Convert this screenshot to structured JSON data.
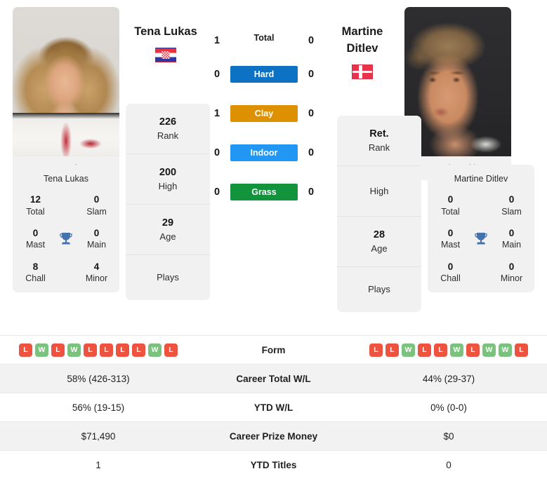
{
  "colors": {
    "hard": "#0D72C4",
    "clay": "#DD9100",
    "indoor": "#2196F3",
    "grass": "#13943C",
    "win": "#7AC27E",
    "loss": "#EE5340",
    "trophy": "#4472AD",
    "card_bg": "#F1F1F1",
    "row_alt_bg": "#F2F2F2"
  },
  "players": {
    "left": {
      "name": "Tena Lukas",
      "photo_caption": "Tena Lukas",
      "flag": "croatia-flag",
      "flag_name": "Croatia",
      "rank": {
        "value": "226",
        "label": "Rank"
      },
      "high": {
        "value": "200",
        "label": "High"
      },
      "age": {
        "value": "29",
        "label": "Age"
      },
      "plays": {
        "value": "",
        "label": "Plays"
      },
      "titles": {
        "total": {
          "value": "12",
          "label": "Total"
        },
        "slam": {
          "value": "0",
          "label": "Slam"
        },
        "mast": {
          "value": "0",
          "label": "Mast"
        },
        "main": {
          "value": "0",
          "label": "Main"
        },
        "chall": {
          "value": "8",
          "label": "Chall"
        },
        "minor": {
          "value": "4",
          "label": "Minor"
        }
      },
      "form": [
        "L",
        "W",
        "L",
        "W",
        "L",
        "L",
        "L",
        "L",
        "W",
        "L"
      ],
      "career_total_wl": "58% (426-313)",
      "ytd_wl": "56% (19-15)",
      "career_prize_money": "$71,490",
      "ytd_titles": "1"
    },
    "right": {
      "name_line1": "Martine",
      "name_line2": "Ditlev",
      "photo_caption": "Martine Ditlev",
      "flag": "denmark-flag",
      "flag_name": "Denmark",
      "rank": {
        "value": "Ret.",
        "label": "Rank"
      },
      "high": {
        "value": "",
        "label": "High"
      },
      "age": {
        "value": "28",
        "label": "Age"
      },
      "plays": {
        "value": "",
        "label": "Plays"
      },
      "titles": {
        "total": {
          "value": "0",
          "label": "Total"
        },
        "slam": {
          "value": "0",
          "label": "Slam"
        },
        "mast": {
          "value": "0",
          "label": "Mast"
        },
        "main": {
          "value": "0",
          "label": "Main"
        },
        "chall": {
          "value": "0",
          "label": "Chall"
        },
        "minor": {
          "value": "0",
          "label": "Minor"
        }
      },
      "form": [
        "L",
        "L",
        "W",
        "L",
        "L",
        "W",
        "L",
        "W",
        "W",
        "L"
      ],
      "career_total_wl": "44% (29-37)",
      "ytd_wl": "0% (0-0)",
      "career_prize_money": "$0",
      "ytd_titles": "0"
    }
  },
  "surfaces": [
    {
      "label": "Total",
      "left": "1",
      "right": "0",
      "style": "plain"
    },
    {
      "label": "Hard",
      "left": "0",
      "right": "0",
      "style": "hard"
    },
    {
      "label": "Clay",
      "left": "1",
      "right": "0",
      "style": "clay"
    },
    {
      "label": "Indoor",
      "left": "0",
      "right": "0",
      "style": "indoor"
    },
    {
      "label": "Grass",
      "left": "0",
      "right": "0",
      "style": "grass"
    }
  ],
  "table": {
    "rows": [
      {
        "label": "Form",
        "kind": "form"
      },
      {
        "label": "Career Total W/L",
        "kind": "text",
        "key": "career_total_wl"
      },
      {
        "label": "YTD W/L",
        "kind": "text",
        "key": "ytd_wl"
      },
      {
        "label": "Career Prize Money",
        "kind": "text",
        "key": "career_prize_money"
      },
      {
        "label": "YTD Titles",
        "kind": "text",
        "key": "ytd_titles"
      }
    ]
  }
}
